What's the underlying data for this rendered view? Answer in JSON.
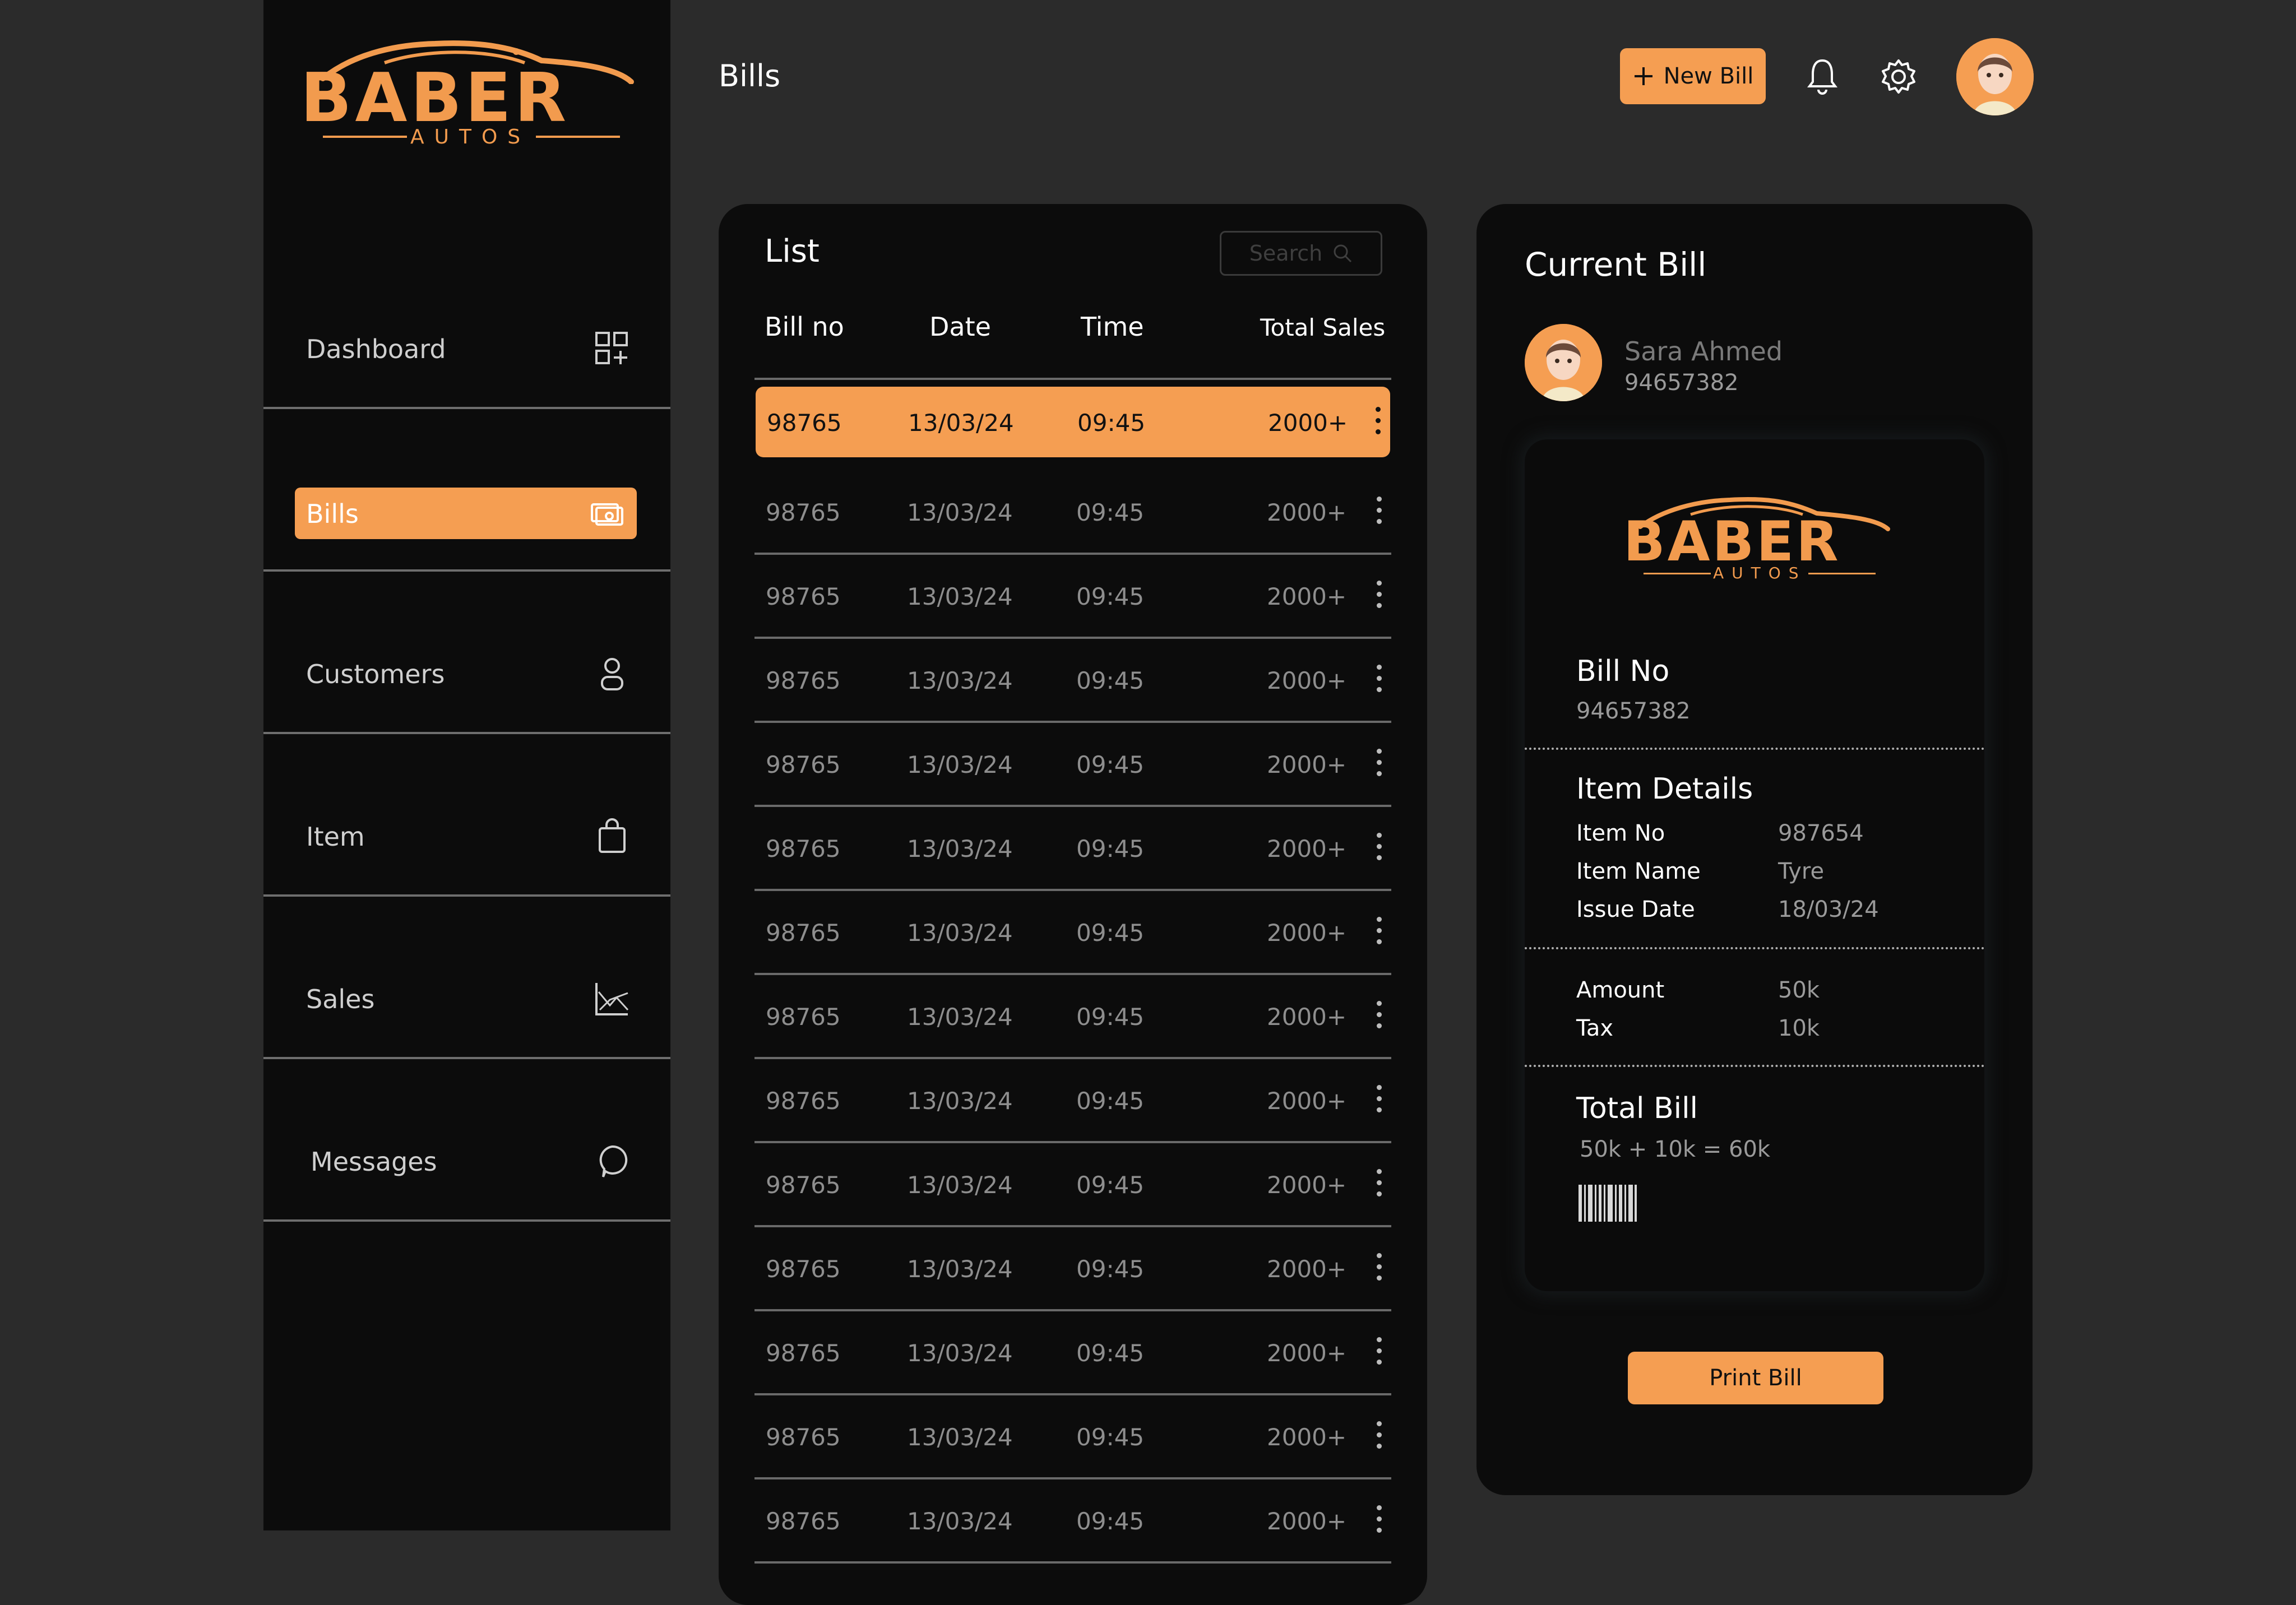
{
  "brand": {
    "name": "BABER",
    "sub": "AUTOS"
  },
  "sidebar": {
    "items": [
      {
        "label": "Dashboard",
        "icon": "dashboard-grid-icon"
      },
      {
        "label": "Bills",
        "icon": "bills-icon",
        "active": true
      },
      {
        "label": "Customers",
        "icon": "user-icon"
      },
      {
        "label": "Item",
        "icon": "shopping-bag-icon"
      },
      {
        "label": "Sales",
        "icon": "chart-icon"
      },
      {
        "label": "Messages",
        "icon": "chat-icon"
      }
    ]
  },
  "header": {
    "title": "Bills",
    "new_bill_label": "New Bill",
    "icons": [
      "bell-icon",
      "gear-icon",
      "avatar"
    ]
  },
  "list": {
    "title": "List",
    "search_placeholder": "Search",
    "columns": [
      "Bill no",
      "Date",
      "Time",
      "Total Sales"
    ],
    "rows": [
      {
        "bill_no": "98765",
        "date": "13/03/24",
        "time": "09:45",
        "total": "2000+"
      },
      {
        "bill_no": "98765",
        "date": "13/03/24",
        "time": "09:45",
        "total": "2000+"
      },
      {
        "bill_no": "98765",
        "date": "13/03/24",
        "time": "09:45",
        "total": "2000+"
      },
      {
        "bill_no": "98765",
        "date": "13/03/24",
        "time": "09:45",
        "total": "2000+"
      },
      {
        "bill_no": "98765",
        "date": "13/03/24",
        "time": "09:45",
        "total": "2000+"
      },
      {
        "bill_no": "98765",
        "date": "13/03/24",
        "time": "09:45",
        "total": "2000+"
      },
      {
        "bill_no": "98765",
        "date": "13/03/24",
        "time": "09:45",
        "total": "2000+"
      },
      {
        "bill_no": "98765",
        "date": "13/03/24",
        "time": "09:45",
        "total": "2000+"
      },
      {
        "bill_no": "98765",
        "date": "13/03/24",
        "time": "09:45",
        "total": "2000+"
      },
      {
        "bill_no": "98765",
        "date": "13/03/24",
        "time": "09:45",
        "total": "2000+"
      },
      {
        "bill_no": "98765",
        "date": "13/03/24",
        "time": "09:45",
        "total": "2000+"
      },
      {
        "bill_no": "98765",
        "date": "13/03/24",
        "time": "09:45",
        "total": "2000+"
      },
      {
        "bill_no": "98765",
        "date": "13/03/24",
        "time": "09:45",
        "total": "2000+"
      },
      {
        "bill_no": "98765",
        "date": "13/03/24",
        "time": "09:45",
        "total": "2000+"
      }
    ]
  },
  "current_bill": {
    "title": "Current Bill",
    "customer": {
      "name": "Sara Ahmed",
      "phone": "94657382"
    },
    "bill_no_label": "Bill No",
    "bill_no": "94657382",
    "item_details_label": "Item Details",
    "item_no_label": "Item No",
    "item_no": "987654",
    "item_name_label": "Item Name",
    "item_name": "Tyre",
    "issue_date_label": "Issue Date",
    "issue_date": "18/03/24",
    "amount_label": "Amount",
    "amount": "50k",
    "tax_label": "Tax",
    "tax": "10k",
    "total_label": "Total Bill",
    "total_formula": "50k + 10k = 60k",
    "print_label": "Print Bill"
  },
  "colors": {
    "accent": "#f59e52",
    "panel": "#0c0c0c",
    "background": "#2b2b2b"
  }
}
